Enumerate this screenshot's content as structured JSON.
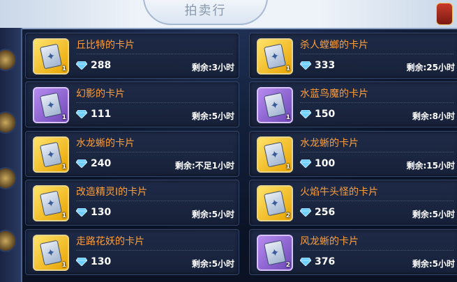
{
  "header": {
    "title": "拍卖行"
  },
  "listings_left": [
    {
      "name": "丘比特的卡片",
      "price": "288",
      "time": "剩余:3小时",
      "qty": "1",
      "rarity": "gold",
      "icon": "card-art-icon"
    },
    {
      "name": "幻影的卡片",
      "price": "111",
      "time": "剩余:5小时",
      "qty": "1",
      "rarity": "purple",
      "icon": "card-art-icon"
    },
    {
      "name": "水龙蜥的卡片",
      "price": "240",
      "time": "剩余:不足1小时",
      "qty": "1",
      "rarity": "gold",
      "icon": "card-art-icon"
    },
    {
      "name": "改造精灵I的卡片",
      "price": "130",
      "time": "剩余:5小时",
      "qty": "1",
      "rarity": "gold",
      "icon": "card-art-icon"
    },
    {
      "name": "走路花妖的卡片",
      "price": "130",
      "time": "剩余:5小时",
      "qty": "1",
      "rarity": "gold",
      "icon": "card-art-icon"
    }
  ],
  "listings_right": [
    {
      "name": "杀人螳螂的卡片",
      "price": "333",
      "time": "剩余:25小时",
      "qty": "1",
      "rarity": "gold",
      "icon": "card-art-icon"
    },
    {
      "name": "水蓝鸟魔的卡片",
      "price": "150",
      "time": "剩余:8小时",
      "qty": "1",
      "rarity": "purple",
      "icon": "card-art-icon"
    },
    {
      "name": "水龙蜥的卡片",
      "price": "100",
      "time": "剩余:15小时",
      "qty": "1",
      "rarity": "gold",
      "icon": "card-art-icon"
    },
    {
      "name": "火焰牛头怪的卡片",
      "price": "256",
      "time": "剩余:5小时",
      "qty": "2",
      "rarity": "gold",
      "icon": "card-art-icon"
    },
    {
      "name": "风龙蜥的卡片",
      "price": "376",
      "time": "剩余:5小时",
      "qty": "2",
      "rarity": "purple",
      "icon": "card-art-icon"
    }
  ],
  "colors": {
    "name": "#ff9f3a",
    "gold_slot": "#ffd23a",
    "purple_slot": "#9a6ee0",
    "gem": "#6fd0ff"
  }
}
